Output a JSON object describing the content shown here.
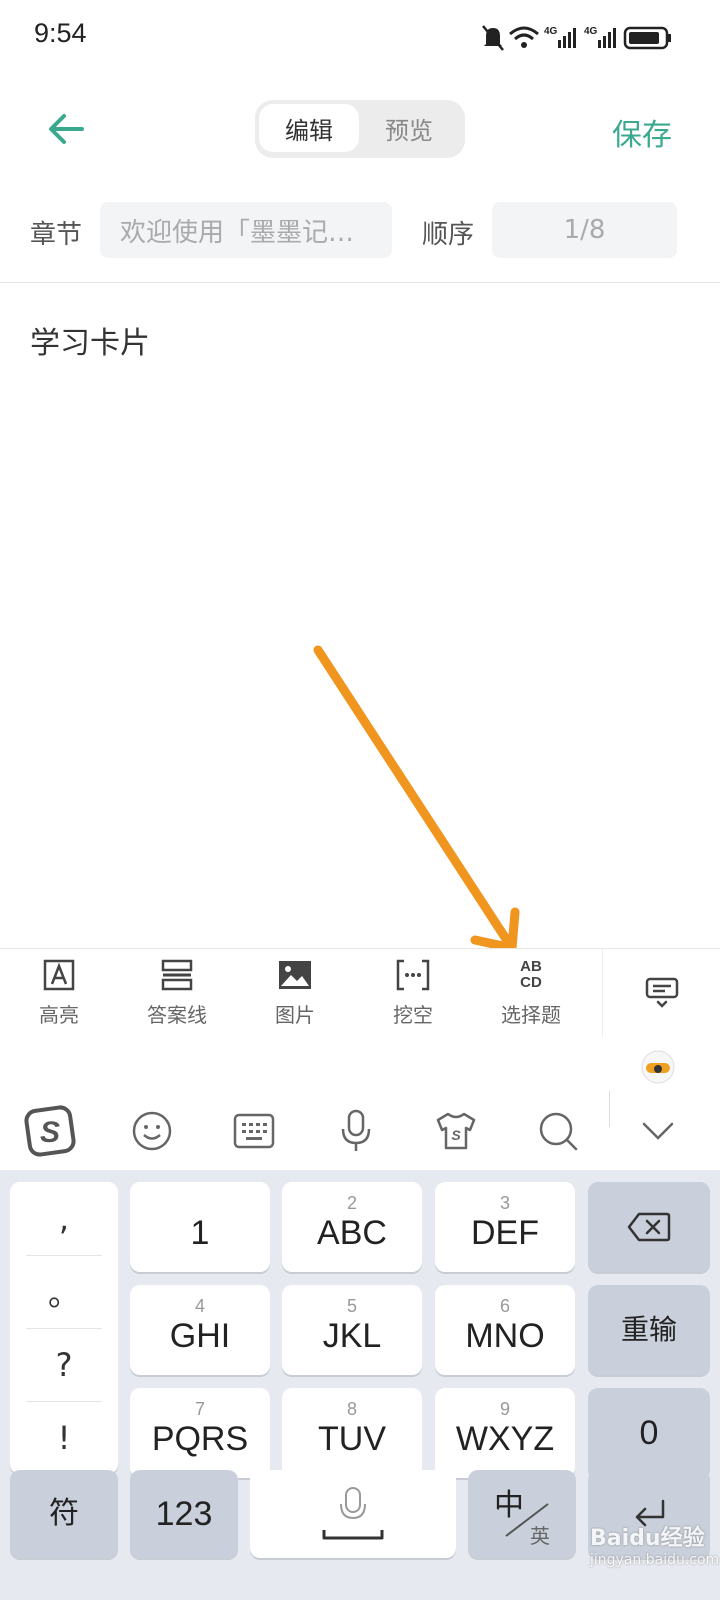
{
  "status_bar": {
    "time": "9:54",
    "network_labels": [
      "4G",
      "4G"
    ]
  },
  "header": {
    "back_icon": "arrow-left-icon",
    "tabs": [
      {
        "label": "编辑",
        "active": true
      },
      {
        "label": "预览",
        "active": false
      }
    ],
    "save_label": "保存"
  },
  "meta": {
    "chapter_label": "章节",
    "chapter_value": "欢迎使用「墨墨记…",
    "order_label": "顺序",
    "order_value": "1/8"
  },
  "editor": {
    "content": "学习卡片"
  },
  "toolbar": {
    "items": [
      {
        "label": "高亮",
        "icon": "highlight-icon"
      },
      {
        "label": "答案线",
        "icon": "answer-line-icon"
      },
      {
        "label": "图片",
        "icon": "image-icon"
      },
      {
        "label": "挖空",
        "icon": "cloze-icon",
        "glyph": "[···]"
      },
      {
        "label": "选择题",
        "icon": "multiple-choice-icon",
        "glyph_top": "AB",
        "glyph_bottom": "CD"
      }
    ],
    "collapse_icon": "keyboard-collapse-icon"
  },
  "ime_bar": {
    "icons": [
      "sogou-logo-icon",
      "emoji-icon",
      "keyboard-icon",
      "microphone-icon",
      "skin-icon",
      "search-icon",
      "chevron-down-icon"
    ],
    "logo_letter": "S"
  },
  "keyboard": {
    "punctuation": [
      ",",
      "。",
      "?",
      "!"
    ],
    "rows": [
      [
        {
          "num": "",
          "label": "1"
        },
        {
          "num": "2",
          "label": "ABC"
        },
        {
          "num": "3",
          "label": "DEF"
        }
      ],
      [
        {
          "num": "4",
          "label": "GHI"
        },
        {
          "num": "5",
          "label": "JKL"
        },
        {
          "num": "6",
          "label": "MNO"
        }
      ],
      [
        {
          "num": "7",
          "label": "PQRS"
        },
        {
          "num": "8",
          "label": "TUV"
        },
        {
          "num": "9",
          "label": "WXYZ"
        }
      ]
    ],
    "delete_icon": "backspace-icon",
    "reset_label": "重输",
    "zero_label": "0",
    "bottom": {
      "symbol_label": "符",
      "numbers_label": "123",
      "space_icon": "microphone-icon",
      "lang_main": "中",
      "lang_alt": "英",
      "enter_icon": "enter-icon"
    }
  },
  "watermark": {
    "text": "Baidu经验",
    "url": "jingyan.baidu.com"
  },
  "colors": {
    "accent": "#3aa98f",
    "arrow": "#f0951e",
    "keyboard_bg": "#e6e9ef",
    "dark_key": "#c9d0db"
  }
}
